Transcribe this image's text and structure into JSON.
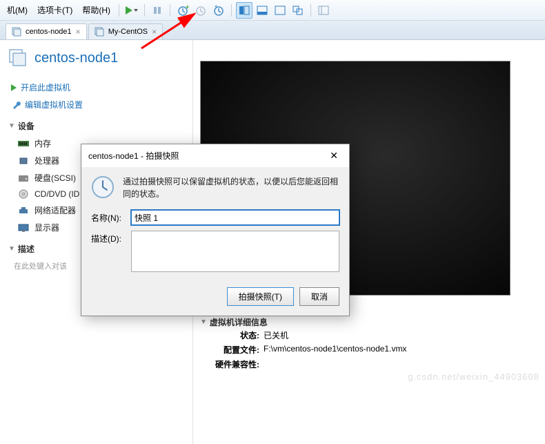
{
  "menu": {
    "vm": "机(M)",
    "tabs": "选项卡(T)",
    "help": "帮助(H)"
  },
  "tabs": [
    {
      "label": "centos-node1",
      "active": true
    },
    {
      "label": "My-CentOS",
      "active": false
    }
  ],
  "vm_title": "centos-node1",
  "actions": {
    "power_on": "开启此虚拟机",
    "edit_settings": "编辑虚拟机设置"
  },
  "sections": {
    "devices": "设备",
    "description": "描述"
  },
  "devices": [
    {
      "name": "内存",
      "icon": "memory"
    },
    {
      "name": "处理器",
      "icon": "cpu"
    },
    {
      "name": "硬盘(SCSI)",
      "icon": "disk"
    },
    {
      "name": "CD/DVD (ID",
      "icon": "cd"
    },
    {
      "name": "网络适配器",
      "icon": "network"
    },
    {
      "name": "显示器",
      "icon": "display"
    }
  ],
  "description_placeholder": "在此处键入对该",
  "dialog": {
    "title": "centos-node1 - 拍摄快照",
    "info_text": "通过拍摄快照可以保留虚拟机的状态，以便以后您能返回相同的状态。",
    "name_label": "名称(N):",
    "name_value": "快照 1",
    "desc_label": "描述(D):",
    "desc_value": "",
    "btn_take": "拍摄快照(T)",
    "btn_cancel": "取消"
  },
  "details": {
    "header": "虚拟机详细信息",
    "state_label": "状态:",
    "state_value": "已关机",
    "config_label": "配置文件:",
    "config_value": "F:\\vm\\centos-node1\\centos-node1.vmx",
    "compat_label": "硬件兼容性:"
  },
  "watermark": "g.csdn.net/weixin_44903608"
}
